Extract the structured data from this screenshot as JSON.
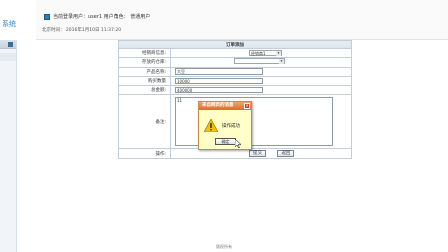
{
  "app": {
    "name": "系统"
  },
  "header": {
    "user_line": "当前登录用户：user1 用户角色： 普通用户",
    "time_line": "北京时间： 2016年1月10日 11:37:20"
  },
  "form": {
    "title": "订单添加",
    "rows": [
      {
        "label": "经销商信息:",
        "type": "select",
        "value": "经销商1"
      },
      {
        "label": "存放的仓库:",
        "type": "select",
        "value": ""
      },
      {
        "label": "产品名称:",
        "type": "input",
        "value": "大豆"
      },
      {
        "label": "购买数量",
        "type": "input",
        "value": "10000"
      },
      {
        "label": "总金额:",
        "type": "input",
        "value": "400000"
      },
      {
        "label": "备注:",
        "type": "textarea",
        "value": "11"
      },
      {
        "label": "操作:",
        "type": "actions"
      }
    ],
    "submit_label": "提交",
    "reset_label": "返回"
  },
  "dialog": {
    "title": "来自网页的消息",
    "message": "操作成功",
    "ok_label": "确定"
  },
  "footer": {
    "text": "版权所有"
  },
  "colors": {
    "dialog_title": "#dc6b2a",
    "dialog_bg": "#ffffc8",
    "accent": "#2f82c4"
  },
  "icons": [
    "user-icon",
    "warning-icon",
    "close-icon",
    "dropdown-arrow-icon",
    "mouse-cursor-icon"
  ]
}
